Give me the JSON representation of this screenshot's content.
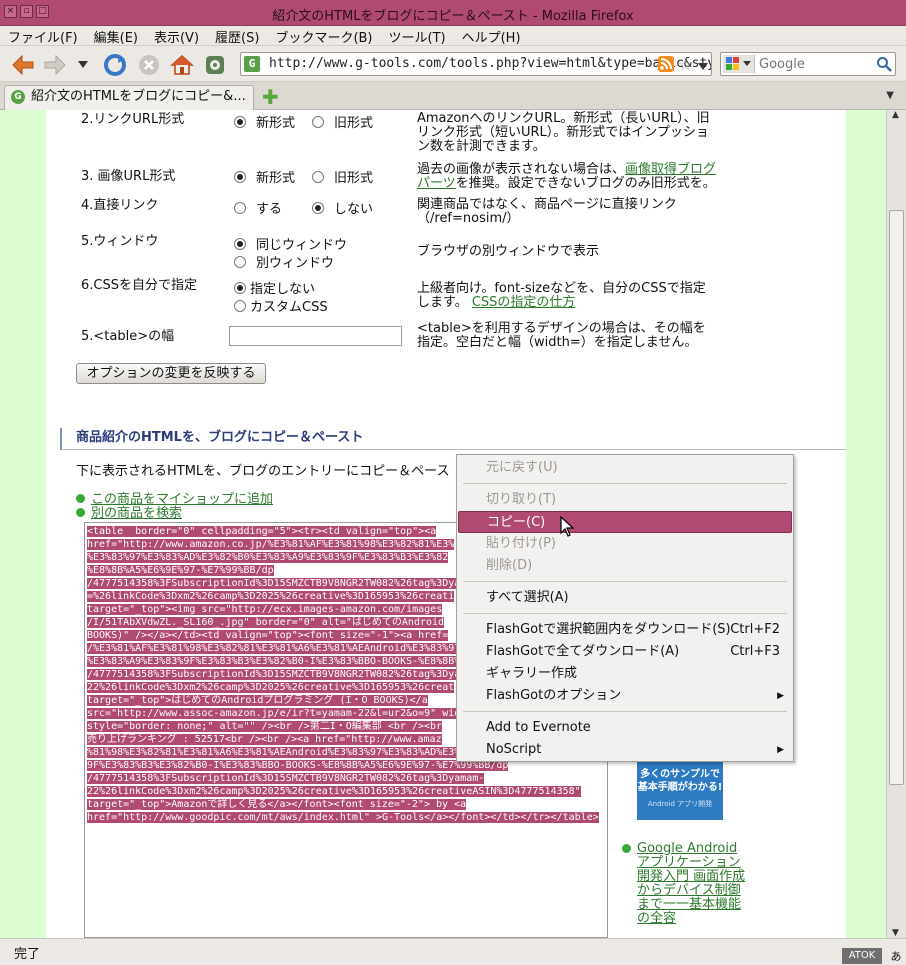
{
  "window": {
    "title": "紹介文のHTMLをブログにコピー＆ペースト - Mozilla Firefox",
    "controls": [
      "×",
      "▫",
      "□"
    ]
  },
  "menubar": [
    "ファイル(F)",
    "編集(E)",
    "表示(V)",
    "履歴(S)",
    "ブックマーク(B)",
    "ツール(T)",
    "ヘルプ(H)"
  ],
  "toolbar": {
    "url": "http://www.g-tools.com/tools.php?view=html&type=basic&sty",
    "search_placeholder": "Google"
  },
  "tab": {
    "label": "紹介文のHTMLをブログにコピー&..."
  },
  "options": [
    {
      "label": "2.リンクURL形式",
      "choices": [
        "新形式",
        "旧形式"
      ],
      "selected": 0,
      "desc": "AmazonへのリンクURL。新形式（長いURL）、旧リンク形式（短いURL）。新形式ではインプッション数を計測できます。"
    },
    {
      "label": "3. 画像URL形式",
      "choices": [
        "新形式",
        "旧形式"
      ],
      "selected": 0,
      "desc_pre": "過去の画像が表示されない場合は、",
      "desc_link": "画像取得ブログパーツ",
      "desc_post": "を推奨。設定できないブログのみ旧形式を。"
    },
    {
      "label": "4.直接リンク",
      "choices": [
        "する",
        "しない"
      ],
      "selected": 1,
      "desc": "関連商品ではなく、商品ページに直接リンク（/ref=nosim/）"
    },
    {
      "label": "5.ウィンドウ",
      "choices": [
        "同じウィンドウ",
        "別ウィンドウ"
      ],
      "selected": 0,
      "desc": "ブラウザの別ウィンドウで表示"
    },
    {
      "label": "6.CSSを自分で指定",
      "choices": [
        "指定しない",
        "カスタムCSS"
      ],
      "selected": 0,
      "desc": "上級者向け。font-sizeなどを、自分のCSSで指定します。",
      "desc_link": "CSSの指定の仕方"
    },
    {
      "label": "5.<table>の幅",
      "desc": "<table>を利用するデザインの場合は、その幅を指定。空白だと幅（width=）を指定しません。"
    }
  ],
  "apply_button": "オプションの変更を反映する",
  "section": {
    "heading": "商品紹介のHTMLを、ブログにコピー＆ペースト",
    "intro": "下に表示されるHTMLを、ブログのエントリーにコピー＆ペース",
    "links": [
      "この商品をマイショップに追加",
      "別の商品を検索"
    ]
  },
  "code_lines": [
    "<table  border=\"0\" cellpadding=\"5\"><tr><td valign=\"top\"><a",
    "href=\"http://www.amazon.co.jp/%E3%81%AF%E3%81%98%E3%82%81%E3%",
    "%E3%83%97%E3%83%AD%E3%82%B0%E3%83%A9%E3%83%9F%E3%83%B3%E3%82",
    "%E8%8B%A5%E6%9E%97-%E7%99%BB/dp",
    "/4777514358%3FSubscriptionId%3D15SMZCTB9V8NGR2TW082%26tag%3Dya",
    "=%26linkCode%3Dxm2%26camp%3D2025%26creative%3D165953%26creati",
    "target=\"_top\"><img src=\"http://ecx.images-amazon.com/images",
    "/I/51TAbXVdwZL._SL160_.jpg\" border=\"0\" alt=\"はじめてのAndroid",
    "BOOKS)\" /></a></td><td valign=\"top\"><font size=\"-1\"><a href=",
    "/%E3%81%AF%E3%81%98%E3%82%81%E3%81%A6%E3%81%AEAndroid%E3%83%97",
    "%E3%83%A9%E3%83%9F%E3%83%B3%E3%82%B0-I%E3%83%BBO-BOOKS-%E8%8B%A5",
    "/4777514358%3FSubscriptionId%3D15SMZCTB9V8NGR2TW082%26tag%3Dya",
    "22%26linkCode%3Dxm2%26camp%3D2025%26creative%3D165953%26creat",
    "target=\"_top\">はじめてのAndroidプログラミング (I・O BOOKS)</a",
    "src=\"http://www.assoc-amazon.jp/e/ir?t=yamam-22&l=ur2&o=9\" wid",
    "style=\"border: none;\" alt=\"\" /><br />第二I・O編集部 <br /><br",
    "売り上げランキング : 52517<br /><br /><a href=\"http://www.amaz",
    "%81%98%E3%82%81%E3%81%A6%E3%81%AEAndroid%E3%83%97%E3%83%AD%E3%",
    "9F%E3%83%B3%E3%82%B0-I%E3%83%BBO-BOOKS-%E8%8B%A5%E6%9E%97-%E7%99%BB/dp",
    "/4777514358%3FSubscriptionId%3D15SMZCTB9V8NGR2TW082%26tag%3Dyamam-",
    "22%26linkCode%3Dxm2%26camp%3D2025%26creative%3D165953%26creativeASIN%3D4777514358\"",
    "target=\"_top\">Amazonで詳しく見る</a></font><font size=\"-2\"> by <a",
    "href=\"http://www.goodpic.com/mt/aws/index.html\" >G-Tools</a></font></td></tr></table>"
  ],
  "book": {
    "line1": "多くのサンプルで",
    "line2": "基本手順がわかる!",
    "sub": "Android アプリ開発",
    "link": "Google Android アプリケーション開発入門 画面作成からデバイス制御まで一一基本機能の全容"
  },
  "context_menu": [
    {
      "label": "元に戻す(U)",
      "disabled": true
    },
    {
      "label": "切り取り(T)",
      "disabled": true
    },
    {
      "label": "コピー(C)",
      "selected": true
    },
    {
      "label": "貼り付け(P)",
      "disabled": true
    },
    {
      "label": "削除(D)",
      "disabled": true
    },
    {
      "label": "すべて選択(A)"
    },
    {
      "label": "FlashGotで選択範囲内をダウンロード(S)",
      "accel": "Ctrl+F2"
    },
    {
      "label": "FlashGotで全てダウンロード(A)",
      "accel": "Ctrl+F3"
    },
    {
      "label": "ギャラリー作成"
    },
    {
      "label": "FlashGotのオプション",
      "submenu": true
    },
    {
      "label": "Add to Evernote"
    },
    {
      "label": "NoScript",
      "submenu": true
    }
  ],
  "statusbar": {
    "text": "完了",
    "ime": "ATOK",
    "ime_mode": "あ"
  }
}
